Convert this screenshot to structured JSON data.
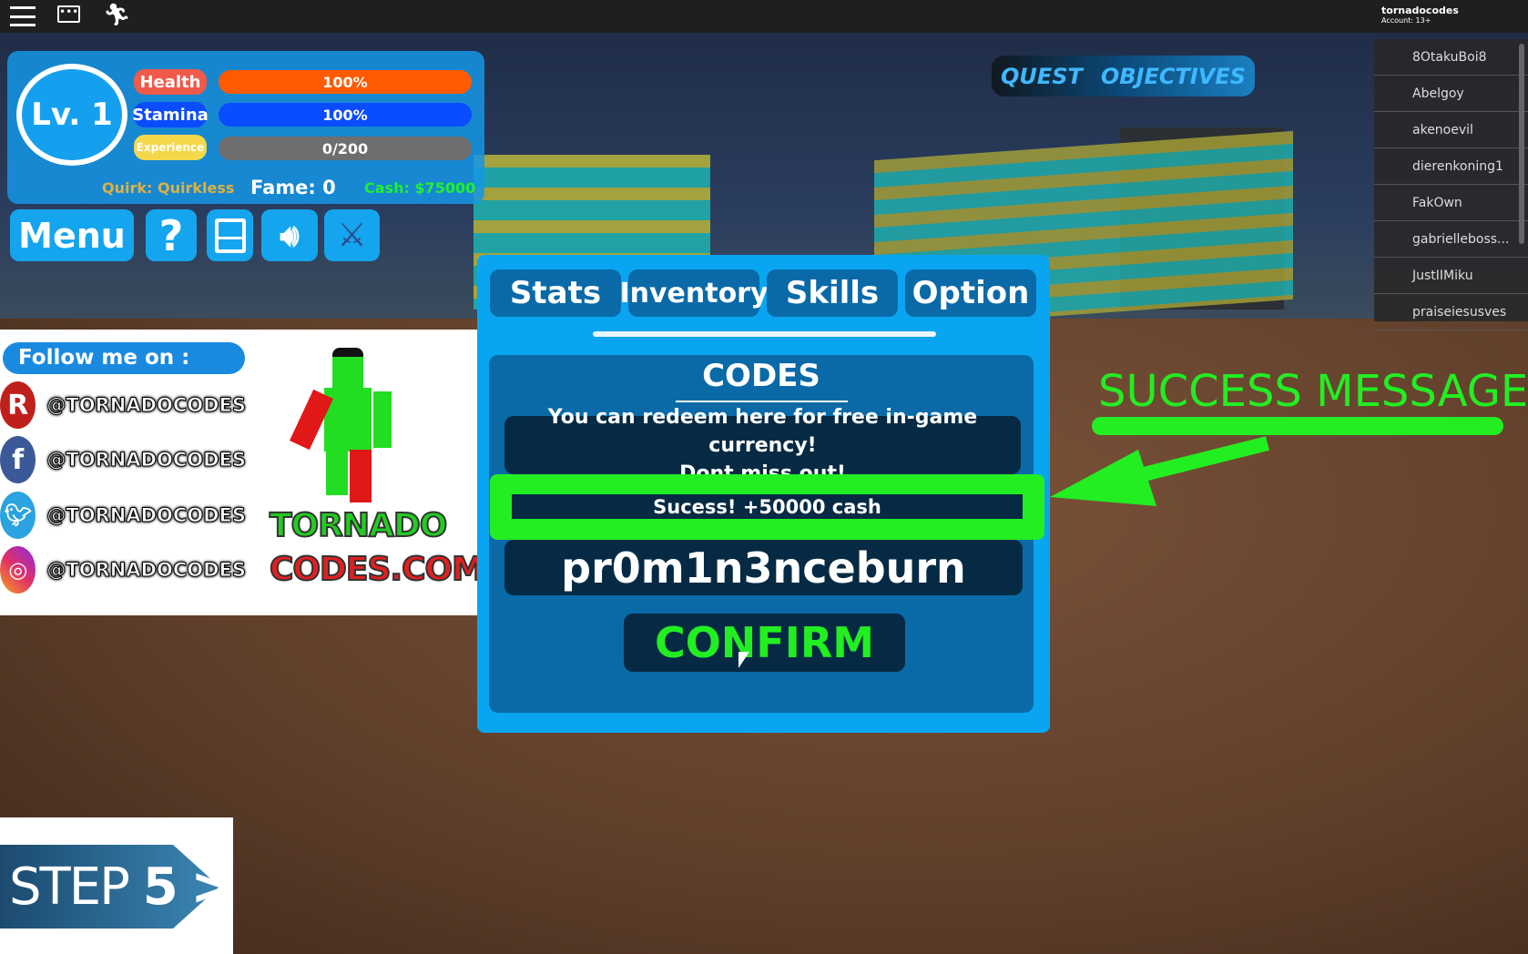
{
  "topbar": {
    "icons": [
      "menu-icon",
      "chat-icon",
      "emote-icon"
    ],
    "username": "tornadocodes",
    "account": "Account: 13+"
  },
  "hud": {
    "level": "Lv. 1",
    "health_label": "Health",
    "health_value": "100%",
    "health_pct": 100,
    "stamina_label": "Stamina",
    "stamina_value": "100%",
    "stamina_pct": 100,
    "exp_label": "Experience",
    "exp_value": "0/200",
    "exp_pct": 0,
    "quirk": "Quirk: Quirkless",
    "fame": "Fame: 0",
    "cash": "Cash: $75000"
  },
  "hud_buttons": {
    "menu": "Menu",
    "help": "?",
    "icons": [
      "save-icon",
      "speaker-icon",
      "crossed-swords-shield-icon"
    ]
  },
  "quest": {
    "quest": "QUEST",
    "objectives": "OBJECTIVES"
  },
  "players": [
    "8OtakuBoi8",
    "Abelgoy",
    "akenoevil",
    "dierenkoning1",
    "FakOwn",
    "gabrielleboss...",
    "JustIIMiku",
    "praiseiesusves"
  ],
  "follow": {
    "title": "Follow me on :",
    "handles": [
      "@TORNADOCODES",
      "@TORNADOCODES",
      "@TORNADOCODES",
      "@TORNADOCODES"
    ],
    "networks": [
      "roblox-icon",
      "facebook-icon",
      "twitter-icon",
      "instagram-icon"
    ],
    "logo_line1": "TORNADO",
    "logo_line2": "CODES.COM"
  },
  "menu": {
    "tabs": [
      "Stats",
      "Inventory",
      "Skills",
      "Option"
    ],
    "section_title": "CODES",
    "description_line1": "You can redeem here for free in-game currency!",
    "description_line2": "Dont miss out!",
    "status": "Sucess! +50000 cash",
    "code_value": "pr0m1n3nceburn",
    "confirm": "CONFIRM"
  },
  "annotation": {
    "text": "SUCCESS MESSAGE",
    "color": "#22ee22"
  },
  "step": {
    "word": "STEP",
    "number": "5",
    "chevron": ">"
  },
  "colors": {
    "health": "#ff5a00",
    "stamina": "#0a4cff",
    "exp": "#6e6e6e",
    "panel": "#0aa5f0",
    "success": "#22ee22"
  }
}
